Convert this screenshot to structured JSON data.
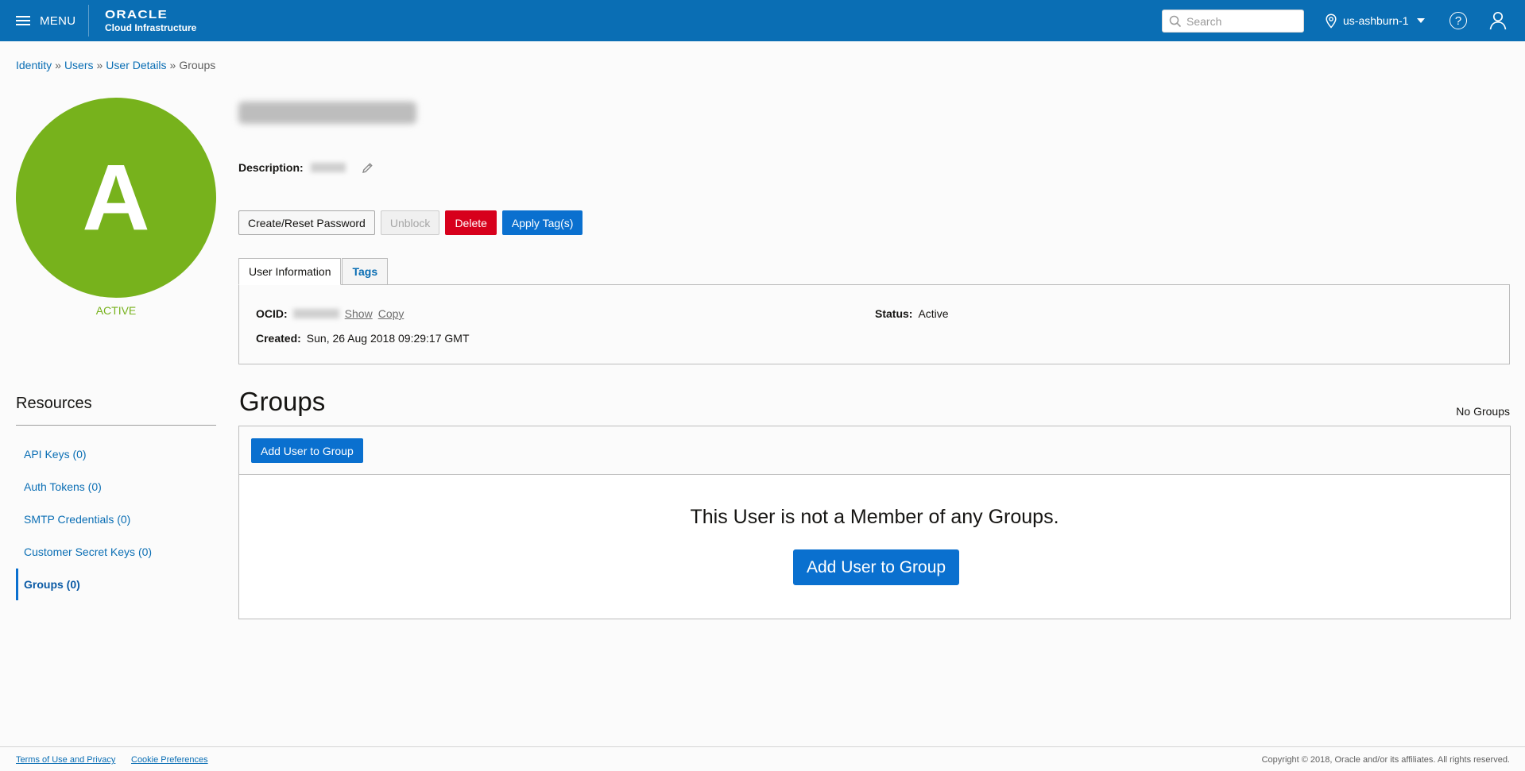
{
  "header": {
    "menu_label": "MENU",
    "logo_word": "ORACLE",
    "logo_sub": "Cloud Infrastructure",
    "search_placeholder": "Search",
    "region": "us-ashburn-1",
    "help_glyph": "?",
    "icons": [
      "menu-icon",
      "search-icon",
      "location-pin-icon",
      "chevron-down-icon",
      "help-icon",
      "user-profile-icon"
    ],
    "brand_color": "#0a6eb4"
  },
  "breadcrumb": {
    "items": [
      "Identity",
      "Users",
      "User Details"
    ],
    "current": "Groups",
    "separator": "»"
  },
  "user": {
    "avatar_letter": "A",
    "avatar_color": "#77b21c",
    "status_label": "ACTIVE",
    "description_label": "Description:",
    "icons": [
      "pencil-icon"
    ]
  },
  "actions": {
    "create_reset_password": "Create/Reset Password",
    "unblock": "Unblock",
    "delete": "Delete",
    "apply_tags": "Apply Tag(s)"
  },
  "tabs": [
    {
      "label": "User Information",
      "active": true
    },
    {
      "label": "Tags",
      "active": false
    }
  ],
  "user_info": {
    "ocid_label": "OCID:",
    "show_link": "Show",
    "copy_link": "Copy",
    "created_label": "Created:",
    "created_value": "Sun, 26 Aug 2018 09:29:17 GMT",
    "status_label": "Status:",
    "status_value": "Active"
  },
  "resources": {
    "title": "Resources",
    "items": [
      {
        "label": "API Keys (0)",
        "selected": false
      },
      {
        "label": "Auth Tokens (0)",
        "selected": false
      },
      {
        "label": "SMTP Credentials (0)",
        "selected": false
      },
      {
        "label": "Customer Secret Keys (0)",
        "selected": false
      },
      {
        "label": "Groups (0)",
        "selected": true
      }
    ]
  },
  "groups": {
    "title": "Groups",
    "count_label": "No Groups",
    "add_button": "Add User to Group",
    "empty_message": "This User is not a Member of any Groups.",
    "empty_add_button": "Add User to Group"
  },
  "footer": {
    "terms": "Terms of Use and Privacy",
    "cookies": "Cookie Preferences",
    "copyright": "Copyright © 2018, Oracle and/or its affiliates. All rights reserved."
  }
}
